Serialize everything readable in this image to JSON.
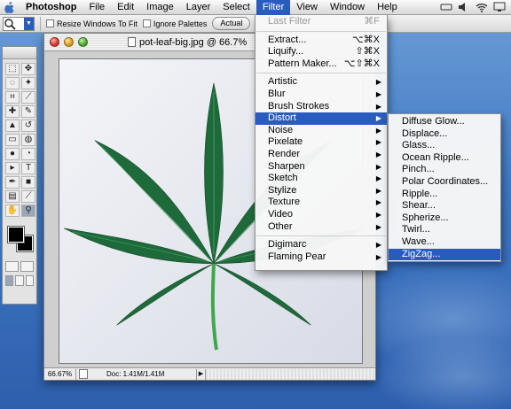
{
  "menubar": {
    "app": "Photoshop",
    "items": [
      "File",
      "Edit",
      "Image",
      "Layer",
      "Select",
      "Filter",
      "View",
      "Window",
      "Help"
    ],
    "active": "Filter",
    "clock": "•"
  },
  "options_bar": {
    "resize_windows_label": "Resize Windows To Fit",
    "ignore_palettes_label": "Ignore Palettes",
    "actual_pixels_label": "Actual"
  },
  "document": {
    "title": "pot-leaf-big.jpg @ 66.7%",
    "zoom": "66.67%",
    "doc_info": "Doc: 1.41M/1.41M",
    "leaf_color": "#1e6a3a"
  },
  "filter_menu": {
    "last_filter": {
      "label": "Last Filter",
      "shortcut": "⌘F"
    },
    "group1": [
      {
        "label": "Extract...",
        "shortcut": "⌥⌘X"
      },
      {
        "label": "Liquify...",
        "shortcut": "⇧⌘X"
      },
      {
        "label": "Pattern Maker...",
        "shortcut": "⌥⇧⌘X"
      }
    ],
    "group2": [
      "Artistic",
      "Blur",
      "Brush Strokes",
      "Distort",
      "Noise",
      "Pixelate",
      "Render",
      "Sharpen",
      "Sketch",
      "Stylize",
      "Texture",
      "Video",
      "Other"
    ],
    "highlighted": "Distort",
    "group3": [
      "Digimarc",
      "Flaming Pear"
    ]
  },
  "distort_submenu": {
    "items": [
      "Diffuse Glow...",
      "Displace...",
      "Glass...",
      "Ocean Ripple...",
      "Pinch...",
      "Polar Coordinates...",
      "Ripple...",
      "Shear...",
      "Spherize...",
      "Twirl...",
      "Wave...",
      "ZigZag..."
    ],
    "highlighted": "ZigZag..."
  },
  "colors": {
    "menu_highlight": "#2a5cc0",
    "desktop": "#3f78c4"
  }
}
